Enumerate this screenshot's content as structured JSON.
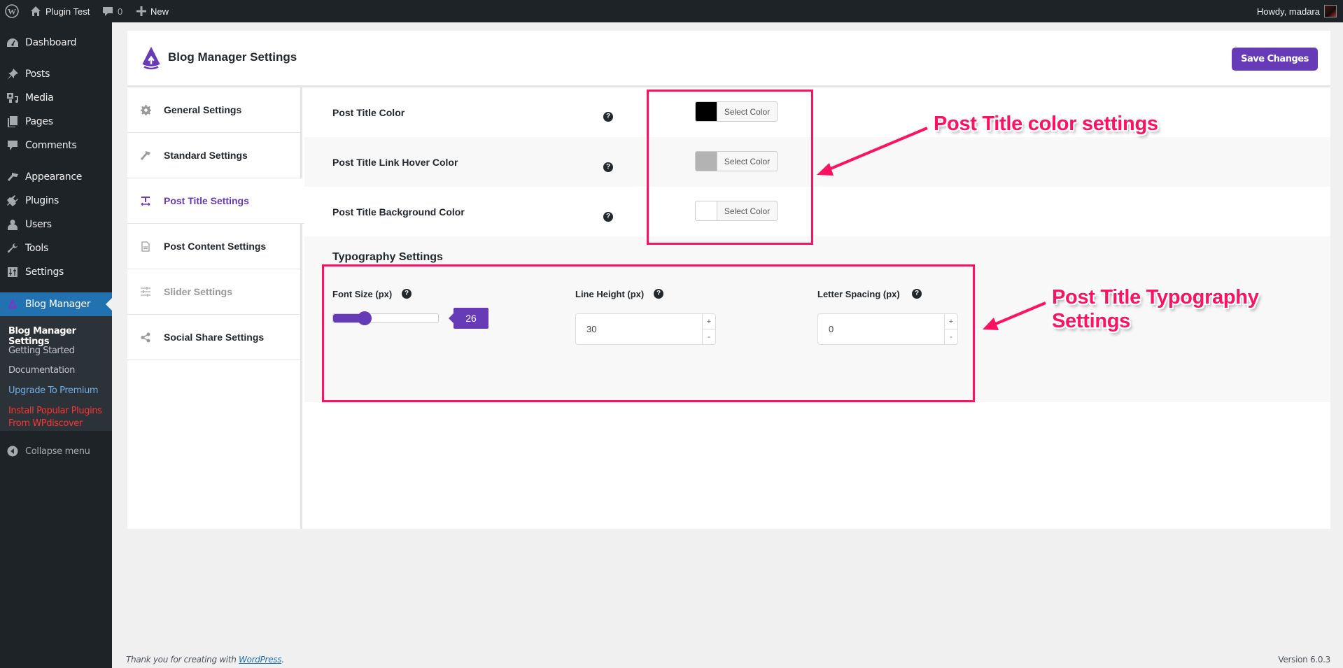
{
  "admin_bar": {
    "site_name": "Plugin Test",
    "comments_count": "0",
    "new_label": "New",
    "greeting": "Howdy, madara",
    "icons": [
      "wordpress-logo-icon",
      "home-icon",
      "comment-icon",
      "plus-icon",
      "avatar"
    ]
  },
  "sidebar": {
    "items": [
      {
        "label": "Dashboard",
        "icon": "dashboard-icon"
      },
      {
        "label": "Posts",
        "icon": "pin-icon"
      },
      {
        "label": "Media",
        "icon": "media-icon"
      },
      {
        "label": "Pages",
        "icon": "pages-icon"
      },
      {
        "label": "Comments",
        "icon": "comment-icon"
      },
      {
        "label": "Appearance",
        "icon": "brush-icon"
      },
      {
        "label": "Plugins",
        "icon": "plug-icon"
      },
      {
        "label": "Users",
        "icon": "user-icon"
      },
      {
        "label": "Tools",
        "icon": "wrench-icon"
      },
      {
        "label": "Settings",
        "icon": "settings-icon"
      },
      {
        "label": "Blog Manager",
        "icon": "blog-manager-logo-icon",
        "current": true
      }
    ],
    "submenu": [
      {
        "label": "Blog Manager Settings",
        "active": true
      },
      {
        "label": "Getting Started"
      },
      {
        "label": "Documentation"
      },
      {
        "label": "Upgrade To Premium",
        "color": "#72aee6"
      },
      {
        "label": "Install Popular Plugins From WPdiscover",
        "color": "#ff3333"
      }
    ],
    "collapse_label": "Collapse menu"
  },
  "header": {
    "title": "Blog Manager Settings",
    "save_label": "Save Changes"
  },
  "tabs": [
    {
      "label": "General Settings",
      "icon": "gear-icon"
    },
    {
      "label": "Standard Settings",
      "icon": "hammer-icon"
    },
    {
      "label": "Post Title Settings",
      "icon": "title-icon",
      "active": true
    },
    {
      "label": "Post Content Settings",
      "icon": "document-icon"
    },
    {
      "label": "Slider Settings",
      "icon": "sliders-icon",
      "disabled": true
    },
    {
      "label": "Social Share Settings",
      "icon": "share-icon"
    }
  ],
  "color_settings": [
    {
      "label": "Post Title Color",
      "value": "#000000",
      "button": "Select Color"
    },
    {
      "label": "Post Title Link Hover Color",
      "value": "#b3b3b3",
      "button": "Select Color"
    },
    {
      "label": "Post Title Background Color",
      "value": "#ffffff",
      "button": "Select Color"
    }
  ],
  "typography": {
    "title": "Typography Settings",
    "font_size": {
      "label": "Font Size (px)",
      "value": "26",
      "fraction": 0.3
    },
    "line_height": {
      "label": "Line Height (px)",
      "value": "30"
    },
    "letter_spacing": {
      "label": "Letter Spacing (px)",
      "value": "0"
    },
    "increment": "+",
    "decrement": "-"
  },
  "annotations": {
    "color": "Post Title color settings",
    "typography_line1": "Post Title Typography",
    "typography_line2": "Settings"
  },
  "footer": {
    "thanks_prefix": "Thank you for creating with ",
    "thanks_link": "WordPress",
    "thanks_suffix": ".",
    "version": "Version 6.0.3"
  },
  "colors": {
    "accent": "#673ab7",
    "highlight": "#ff1162",
    "wp_blue": "#2271b1"
  }
}
